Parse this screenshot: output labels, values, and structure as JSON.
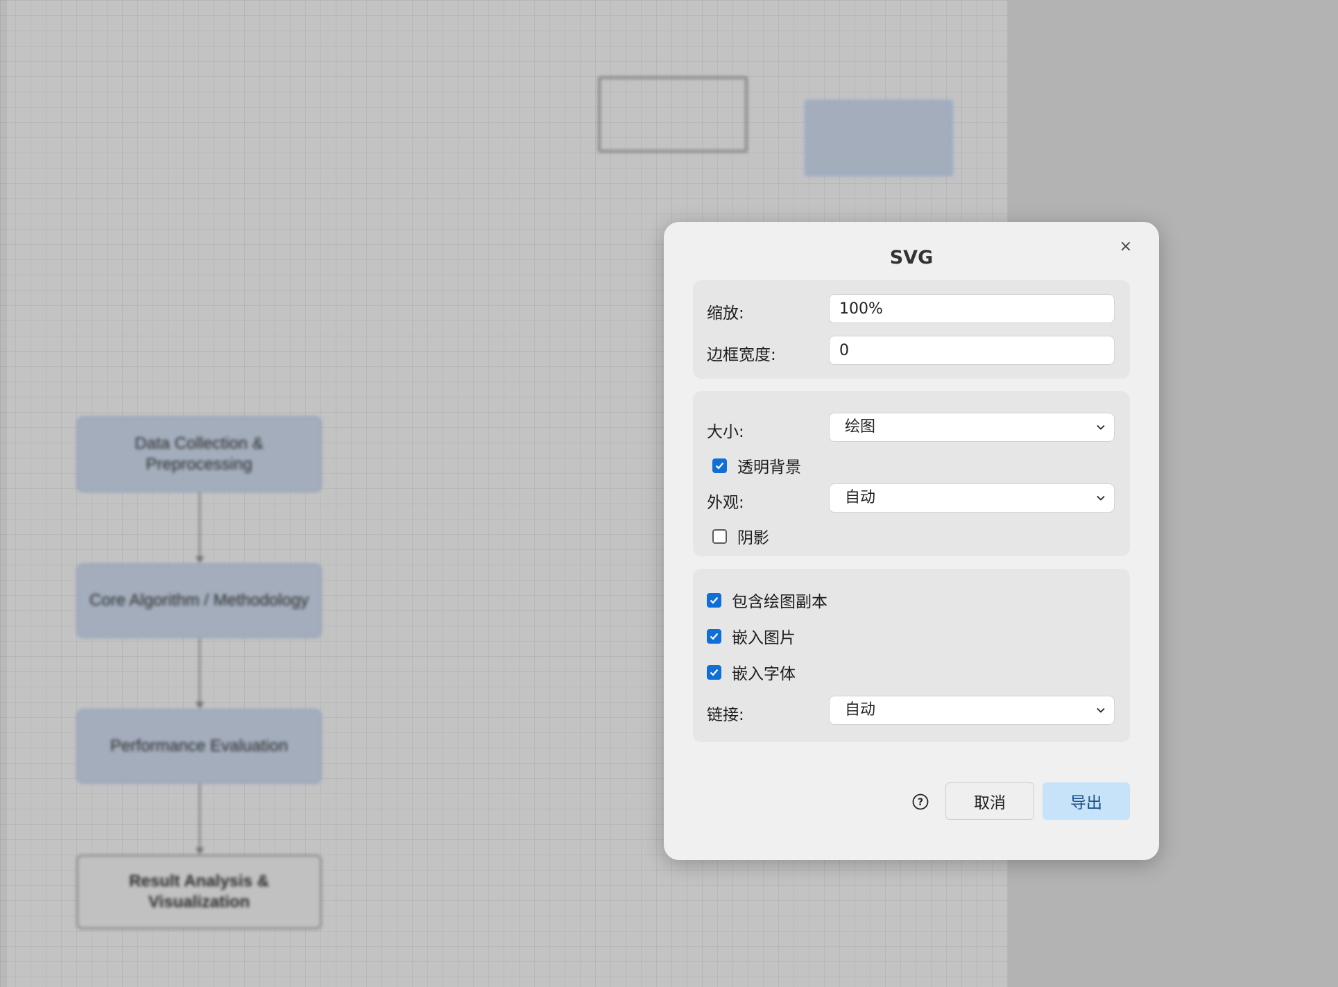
{
  "canvas": {
    "flow_steps": [
      "Data Collection & Preprocessing",
      "Core Algorithm / Methodology",
      "Performance Evaluation",
      "Result Analysis & Visualization"
    ]
  },
  "dialog": {
    "title": "SVG",
    "close_icon": "×",
    "zoom": {
      "label": "缩放:",
      "value": "100%"
    },
    "border_width": {
      "label": "边框宽度:",
      "value": "0"
    },
    "size": {
      "label": "大小:",
      "value": "绘图"
    },
    "transparent_background": {
      "label": "透明背景",
      "checked": true
    },
    "appearance": {
      "label": "外观:",
      "value": "自动"
    },
    "shadow": {
      "label": "阴影",
      "checked": false
    },
    "include_copy": {
      "label": "包含绘图副本",
      "checked": true
    },
    "embed_images": {
      "label": "嵌入图片",
      "checked": true
    },
    "embed_fonts": {
      "label": "嵌入字体",
      "checked": true
    },
    "links": {
      "label": "链接:",
      "value": "自动"
    },
    "help_icon": "?",
    "cancel_label": "取消",
    "export_label": "导出"
  },
  "colors": {
    "accent": "#0f6fd6",
    "export_button_bg": "#c6e3f9",
    "node_fill": "#a3adbc"
  }
}
